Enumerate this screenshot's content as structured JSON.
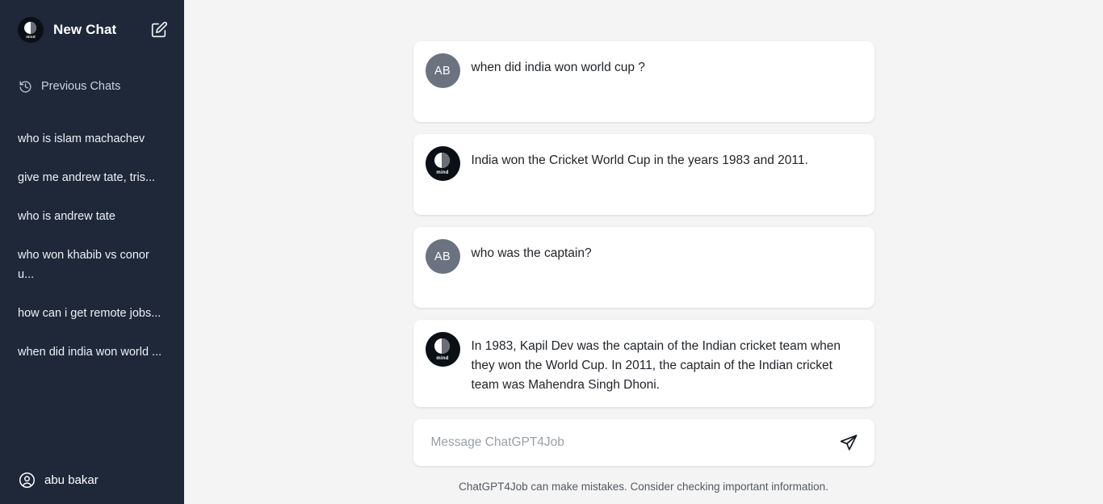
{
  "colors": {
    "sidebar_bg": "#1e2839",
    "main_bg": "#f4f4f5",
    "card_bg": "#ffffff",
    "user_avatar_bg": "#6b7280",
    "bot_avatar_bg": "#0b0f16",
    "text_primary": "#1f2328",
    "text_muted": "#9aa0a6"
  },
  "sidebar": {
    "brand": {
      "logo_icon": "mindcase-logo-icon",
      "logo_wordmark": "mind",
      "title": "New Chat"
    },
    "compose_icon": "compose-edit-icon",
    "previous_chats": {
      "icon": "history-clock-icon",
      "label": "Previous Chats"
    },
    "chats": [
      {
        "label": "who is islam machachev"
      },
      {
        "label": "give me andrew tate, tris..."
      },
      {
        "label": "who is andrew tate"
      },
      {
        "label": "who won khabib vs conor u..."
      },
      {
        "label": "how can i get remote jobs..."
      },
      {
        "label": "when did india won world ..."
      }
    ],
    "user": {
      "icon": "user-circle-icon",
      "name": "abu bakar"
    }
  },
  "conversation": {
    "messages": [
      {
        "role": "user",
        "avatar_initials": "AB",
        "avatar_icon": "user-initials-avatar",
        "text": "when did india won world cup ?"
      },
      {
        "role": "assistant",
        "avatar_icon": "mindcase-logo-icon",
        "avatar_wordmark": "mind",
        "text": "India won the Cricket World Cup in the years 1983 and 2011."
      },
      {
        "role": "user",
        "avatar_initials": "AB",
        "avatar_icon": "user-initials-avatar",
        "text": "who was the captain?"
      },
      {
        "role": "assistant",
        "avatar_icon": "mindcase-logo-icon",
        "avatar_wordmark": "mind",
        "text": "In 1983, Kapil Dev was the captain of the Indian cricket team when they won the World Cup. In 2011, the captain of the Indian cricket team was Mahendra Singh Dhoni."
      }
    ]
  },
  "composer": {
    "placeholder": "Message ChatGPT4Job",
    "value": "",
    "send_icon": "send-paper-plane-icon"
  },
  "footer": {
    "disclaimer": "ChatGPT4Job can make mistakes. Consider checking important information."
  }
}
